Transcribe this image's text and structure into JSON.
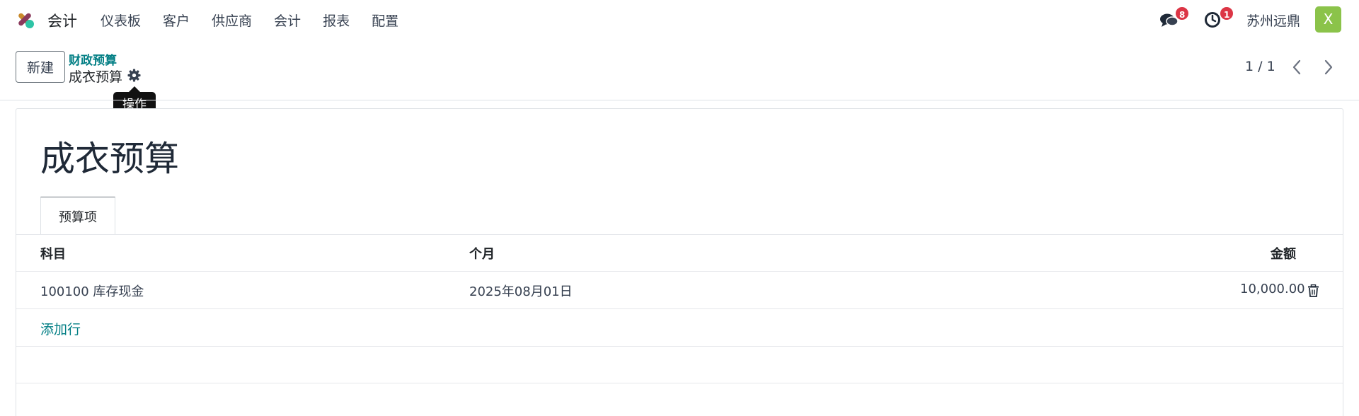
{
  "navbar": {
    "app_name": "会计",
    "menu": [
      "仪表板",
      "客户",
      "供应商",
      "会计",
      "报表",
      "配置"
    ],
    "chat_badge": "8",
    "activity_badge": "1",
    "company": "苏州远鼎",
    "avatar_letter": "X"
  },
  "control": {
    "new_button": "新建",
    "breadcrumb_parent": "财政预算",
    "breadcrumb_current": "成衣预算",
    "tooltip": "操作",
    "pager": "1 / 1"
  },
  "form": {
    "title": "成衣预算",
    "tab": "预算项",
    "columns": {
      "account": "科目",
      "month": "个月",
      "amount": "金额"
    },
    "rows": [
      {
        "account": "100100 库存现金",
        "month": "2025年08月01日",
        "amount": "10,000.00"
      }
    ],
    "add_line": "添加行"
  },
  "colors": {
    "accent": "#017e84",
    "badge": "#dc3545",
    "avatar": "#8bc34a"
  },
  "icons": [
    "app-logo-icon",
    "chat-icon",
    "clock-icon",
    "gear-icon",
    "chevron-left-icon",
    "chevron-right-icon",
    "trash-icon"
  ]
}
